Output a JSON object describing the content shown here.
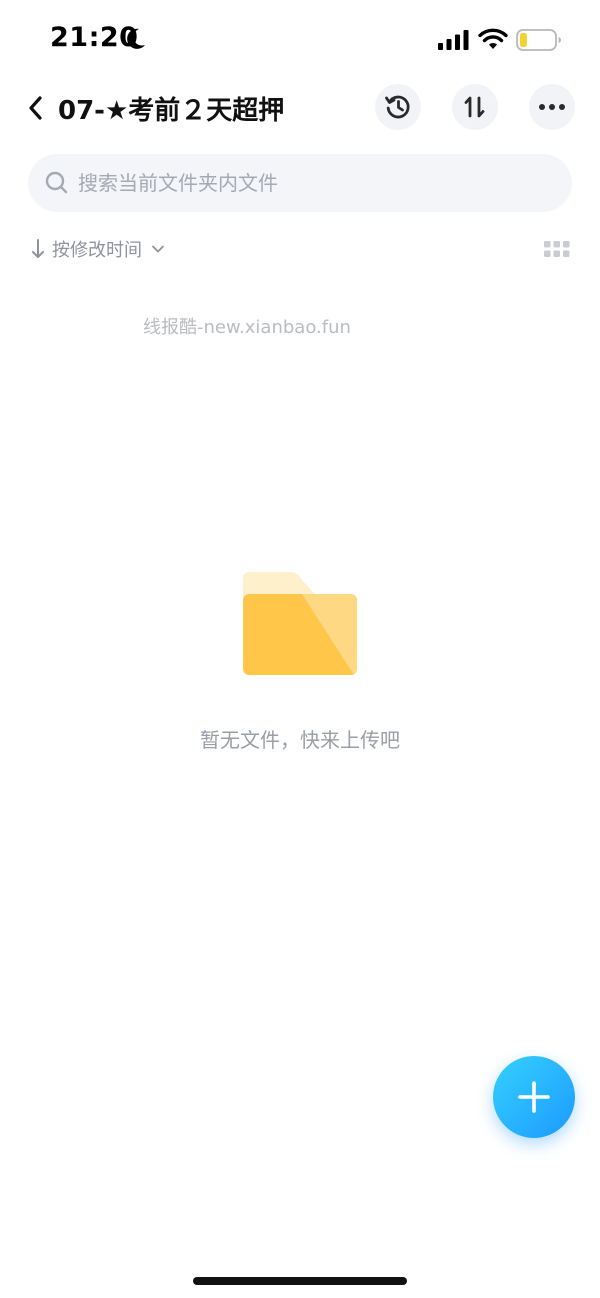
{
  "status_bar": {
    "time": "21:20",
    "icons": [
      "moon-icon",
      "signal-icon",
      "wifi-icon",
      "battery-icon"
    ]
  },
  "nav": {
    "title": "07-★考前２天超押",
    "back_icon": "chevron-left-icon",
    "actions": [
      "history-icon",
      "sort-icon",
      "more-icon"
    ]
  },
  "search": {
    "placeholder": "搜索当前文件夹内文件",
    "value": ""
  },
  "sort": {
    "label": "按修改时间"
  },
  "watermark": "线报酷-new.xianbao.fun",
  "empty_state": {
    "message": "暂无文件，快来上传吧"
  },
  "colors": {
    "accent": "#1b9bff",
    "folder_primary": "#ffc64a",
    "folder_light": "#fff0cc",
    "battery_fill": "#f5d033"
  }
}
